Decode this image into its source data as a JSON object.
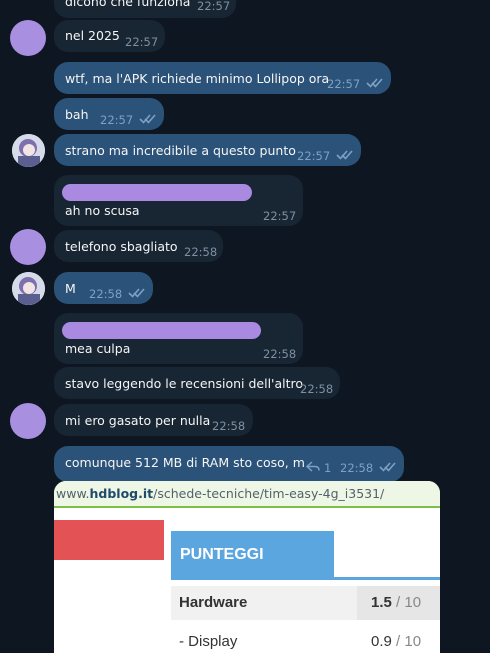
{
  "messages": [
    {
      "text": "dicono che funziona",
      "time": "22:57"
    },
    {
      "text": "nel 2025",
      "time": "22:57"
    },
    {
      "text": "wtf, ma l'APK richiede minimo Lollipop ora",
      "time": "22:57"
    },
    {
      "text": "bah",
      "time": "22:57"
    },
    {
      "text": "strano ma incredibile a questo punto",
      "time": "22:57"
    },
    {
      "text": "ah no scusa",
      "time": "22:57"
    },
    {
      "text": "telefono sbagliato",
      "time": "22:58"
    },
    {
      "text": "M",
      "time": "22:58"
    },
    {
      "text": "mea culpa",
      "time": "22:58"
    },
    {
      "text": "stavo leggendo le recensioni dell'altro",
      "time": "22:58"
    },
    {
      "text": "mi ero gasato per nulla",
      "time": "22:58"
    },
    {
      "text": "comunque 512 MB di RAM sto coso, m",
      "time": "22:58",
      "replies": "1"
    }
  ],
  "preview": {
    "url_prefix": "www.",
    "url_domain": "hdblog.it",
    "url_path": "/schede-tecniche/tim-easy-4g_i3531/",
    "section_title": "PUNTEGGI",
    "rows": [
      {
        "label": "Hardware",
        "score": "1.5",
        "max": " / 10"
      },
      {
        "label": "- Display",
        "score": "0.9",
        "max": " / 10"
      }
    ]
  },
  "colors": {
    "background": "#0e1621",
    "incoming": "#182533",
    "outgoing": "#2b5278",
    "avatar": "#a88fe0"
  }
}
